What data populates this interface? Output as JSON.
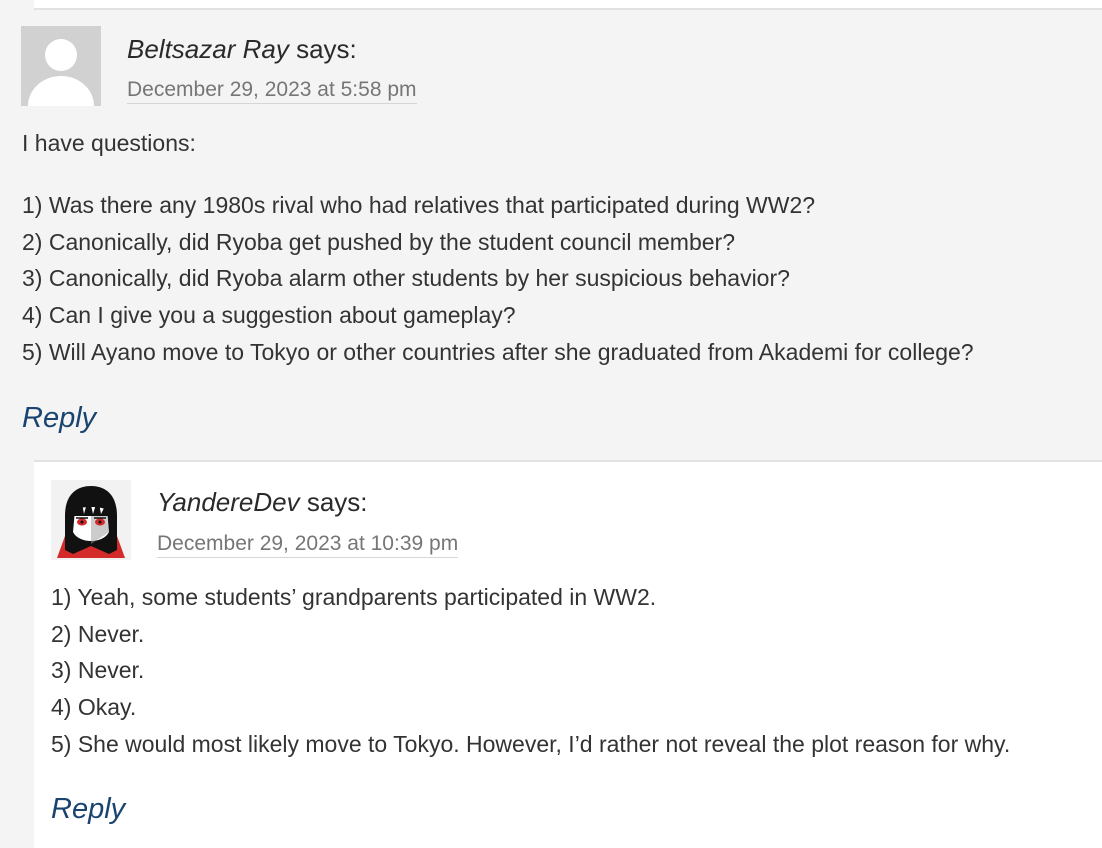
{
  "comments": [
    {
      "author": "Beltsazar Ray",
      "says": "says:",
      "date": "December 29, 2023 at 5:58 pm",
      "intro": "I have questions:",
      "lines": [
        "1) Was there any 1980s rival who had relatives that participated during WW2?",
        "2) Canonically, did Ryoba get pushed by the student council member?",
        "3) Canonically, did Ryoba alarm other students by her suspicious behavior?",
        "4) Can I give you a suggestion about gameplay?",
        "5) Will Ayano move to Tokyo or other countries after she graduated from Akademi for college?"
      ],
      "reply_label": "Reply"
    },
    {
      "author": "YandereDev",
      "says": "says:",
      "date": "December 29, 2023 at 10:39 pm",
      "lines": [
        "1) Yeah, some students’ grandparents participated in WW2.",
        "2) Never.",
        "3) Never.",
        "4) Okay.",
        "5) She would most likely move to Tokyo. However, I’d rather not reveal the plot reason for why."
      ],
      "reply_label": "Reply"
    }
  ]
}
